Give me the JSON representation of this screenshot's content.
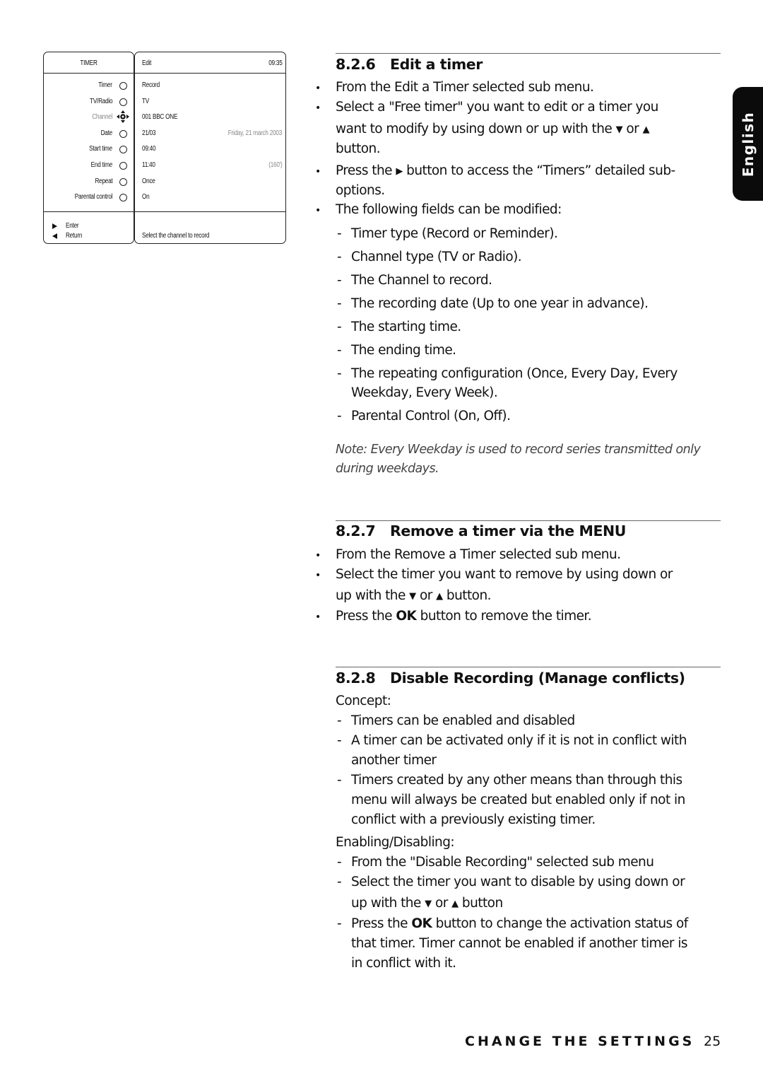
{
  "osd": {
    "left_title": "TIMER",
    "right_title": "Edit",
    "clock": "09:35",
    "rows": [
      {
        "label": "Timer",
        "value": "Record",
        "extra": "",
        "control": "radio",
        "dim": false
      },
      {
        "label": "TV/Radio",
        "value": "TV",
        "extra": "",
        "control": "radio",
        "dim": false
      },
      {
        "label": "Channel",
        "value": "001 BBC ONE",
        "extra": "",
        "control": "nav",
        "dim": true
      },
      {
        "label": "Date",
        "value": "21/03",
        "extra": "Friday, 21 march 2003",
        "control": "radio",
        "dim": false
      },
      {
        "label": "Start time",
        "value": "09:40",
        "extra": "",
        "control": "radio",
        "dim": false
      },
      {
        "label": "End time",
        "value": "11:40",
        "extra": "(160')",
        "control": "radio",
        "dim": false
      },
      {
        "label": "Repeat",
        "value": "Once",
        "extra": "",
        "control": "radio",
        "dim": false
      },
      {
        "label": "Parental control",
        "value": "On",
        "extra": "",
        "control": "radio",
        "dim": false
      }
    ],
    "footer_enter": "Enter",
    "footer_return": "Return",
    "hint": "Select the channel to record"
  },
  "language_tab": "English",
  "sections": {
    "s826": {
      "number": "8.2.6",
      "title": "Edit a timer",
      "b1": "From the Edit a Timer selected sub menu.",
      "b2_l1": "Select a \"Free timer\" you want to edit or a timer you",
      "b2_l2a": "want to modify by using down or up with the",
      "down": "▼",
      "or": "or",
      "up": "▲",
      "b2_l3": "button.",
      "b3_l1a": "Press the",
      "right": "▶",
      "b3_l1b": "button to access the “Timers” detailed sub-",
      "b3_l2": "options.",
      "b4": "The following fields can be modified:",
      "fields": [
        "Timer type (Record or Reminder).",
        "Channel type (TV or Radio).",
        "The Channel to record.",
        "The recording date (Up to one year in advance).",
        "The starting time.",
        "The ending time.",
        "The repeating configuration (Once, Every Day, Every",
        "Weekday, Every Week).",
        "Parental Control (On, Off)."
      ],
      "note_l1": "Note: Every Weekday is used to record series transmitted only",
      "note_l2": "during weekdays."
    },
    "s827": {
      "number": "8.2.7",
      "title": "Remove a timer via the MENU",
      "b1": "From the Remove a Timer selected sub menu.",
      "b2_l1": "Select the timer you want to remove by using down or",
      "b2_l2a": "up with the",
      "b2_l2b": "button.",
      "b3a": "Press the",
      "ok": "OK",
      "b3b": "button to remove the timer."
    },
    "s828": {
      "number": "8.2.8",
      "title": "Disable Recording (Manage conflicts)",
      "concept": "Concept:",
      "c1": "Timers can be enabled and disabled",
      "c2_l1": "A timer can be activated only if it is not in conflict with",
      "c2_l2": "another timer",
      "c3_l1": "Timers created by any other means than through  this",
      "c3_l2": "menu will always be created but enabled only if not in",
      "c3_l3": "conflict with a previously existing timer.",
      "enabling": "Enabling/Disabling:",
      "e1": "From the \"Disable Recording\" selected sub menu",
      "e2_l1": "Select the timer you want to disable by using down or",
      "e2_l2a": "up with the",
      "e2_l2b": "button",
      "e3_l1a": "Press the",
      "ok": "OK",
      "e3_l1b": "button to change the activation status of",
      "e3_l2": "that timer. Timer cannot be enabled if another timer is",
      "e3_l3": "in conflict with it."
    }
  },
  "footer": {
    "chapter": "CHANGE THE SETTINGS",
    "page": "25"
  }
}
